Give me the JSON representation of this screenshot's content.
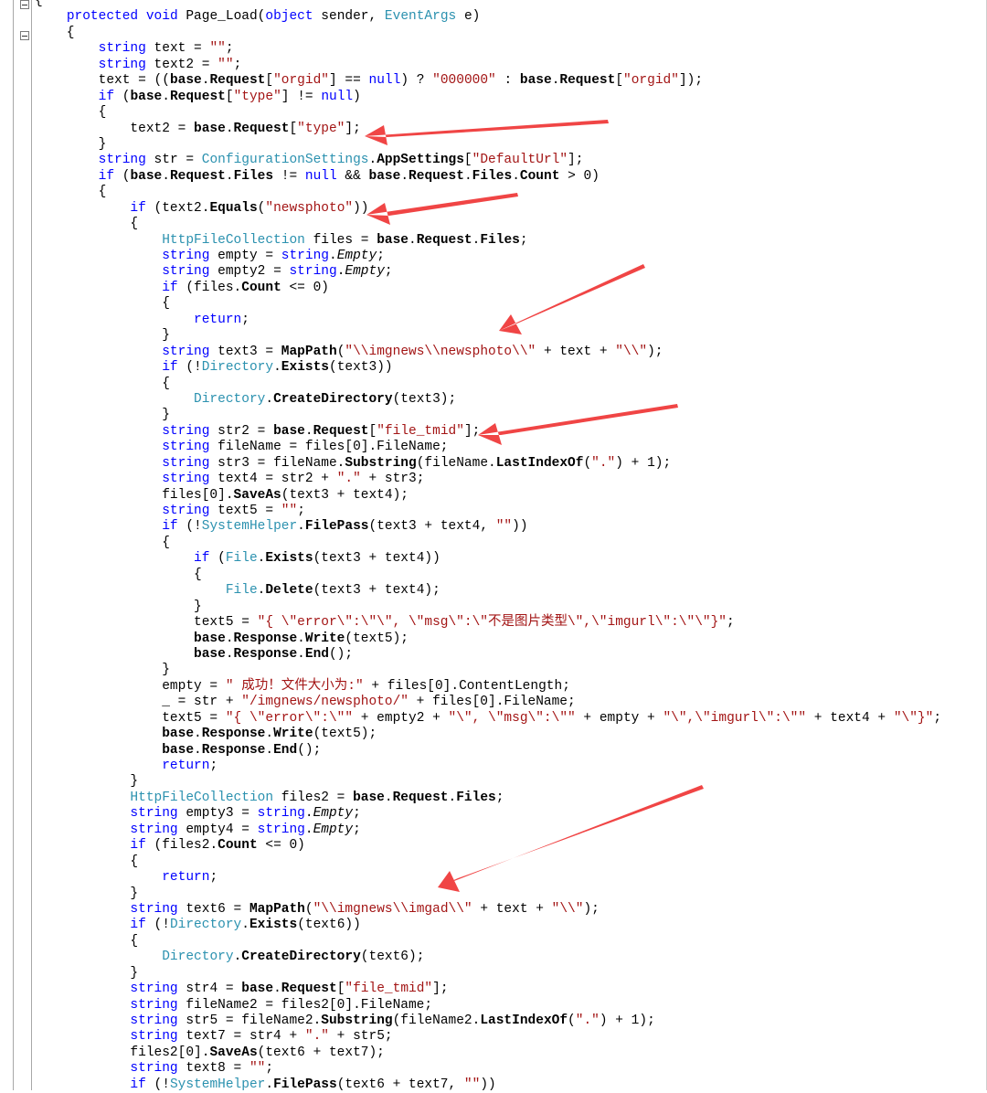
{
  "editor": {
    "lines": [
      "{",
      "    protected void Page_Load(object sender, EventArgs e)",
      "    {",
      "        string text = \"\";",
      "        string text2 = \"\";",
      "        text = ((base.Request[\"orgid\"] == null) ? \"000000\" : base.Request[\"orgid\"]);",
      "        if (base.Request[\"type\"] != null)",
      "        {",
      "            text2 = base.Request[\"type\"];",
      "        }",
      "        string str = ConfigurationSettings.AppSettings[\"DefaultUrl\"];",
      "        if (base.Request.Files != null && base.Request.Files.Count > 0)",
      "        {",
      "            if (text2.Equals(\"newsphoto\"))",
      "            {",
      "                HttpFileCollection files = base.Request.Files;",
      "                string empty = string.Empty;",
      "                string empty2 = string.Empty;",
      "                if (files.Count <= 0)",
      "                {",
      "                    return;",
      "                }",
      "                string text3 = MapPath(\"\\\\imgnews\\\\newsphoto\\\\\" + text + \"\\\\\");",
      "                if (!Directory.Exists(text3))",
      "                {",
      "                    Directory.CreateDirectory(text3);",
      "                }",
      "                string str2 = base.Request[\"file_tmid\"];",
      "                string fileName = files[0].FileName;",
      "                string str3 = fileName.Substring(fileName.LastIndexOf(\".\") + 1);",
      "                string text4 = str2 + \".\" + str3;",
      "                files[0].SaveAs(text3 + text4);",
      "                string text5 = \"\";",
      "                if (!SystemHelper.FilePass(text3 + text4, \"\"))",
      "                {",
      "                    if (File.Exists(text3 + text4))",
      "                    {",
      "                        File.Delete(text3 + text4);",
      "                    }",
      "                    text5 = \"{ \\\"error\\\":\\\"\\\", \\\"msg\\\":\\\"不是图片类型\\\",\\\"imgurl\\\":\\\"\\\"}\";",
      "                    base.Response.Write(text5);",
      "                    base.Response.End();",
      "                }",
      "                empty = \" 成功！文件大小为:\" + files[0].ContentLength;",
      "                _ = str + \"/imgnews/newsphoto/\" + files[0].FileName;",
      "                text5 = \"{ \\\"error\\\":\\\"\" + empty2 + \"\\\", \\\"msg\\\":\\\"\" + empty + \"\\\",\\\"imgurl\\\":\\\"\" + text4 + \"\\\"}\";",
      "                base.Response.Write(text5);",
      "                base.Response.End();",
      "                return;",
      "            }",
      "            HttpFileCollection files2 = base.Request.Files;",
      "            string empty3 = string.Empty;",
      "            string empty4 = string.Empty;",
      "            if (files2.Count <= 0)",
      "            {",
      "                return;",
      "            }",
      "            string text6 = MapPath(\"\\\\imgnews\\\\imgad\\\\\" + text + \"\\\\\");",
      "            if (!Directory.Exists(text6))",
      "            {",
      "                Directory.CreateDirectory(text6);",
      "            }",
      "            string str4 = base.Request[\"file_tmid\"];",
      "            string fileName2 = files2[0].FileName;",
      "            string str5 = fileName2.Substring(fileName2.LastIndexOf(\".\") + 1);",
      "            string text7 = str4 + \".\" + str5;",
      "            files2[0].SaveAs(text6 + text7);",
      "            string text8 = \"\";",
      "            if (!SystemHelper.FilePass(text6 + text7, \"\"))"
    ]
  },
  "colors": {
    "keyword": "#0000ff",
    "type": "#2b91af",
    "string": "#a31515",
    "arrow": "#f04545"
  }
}
